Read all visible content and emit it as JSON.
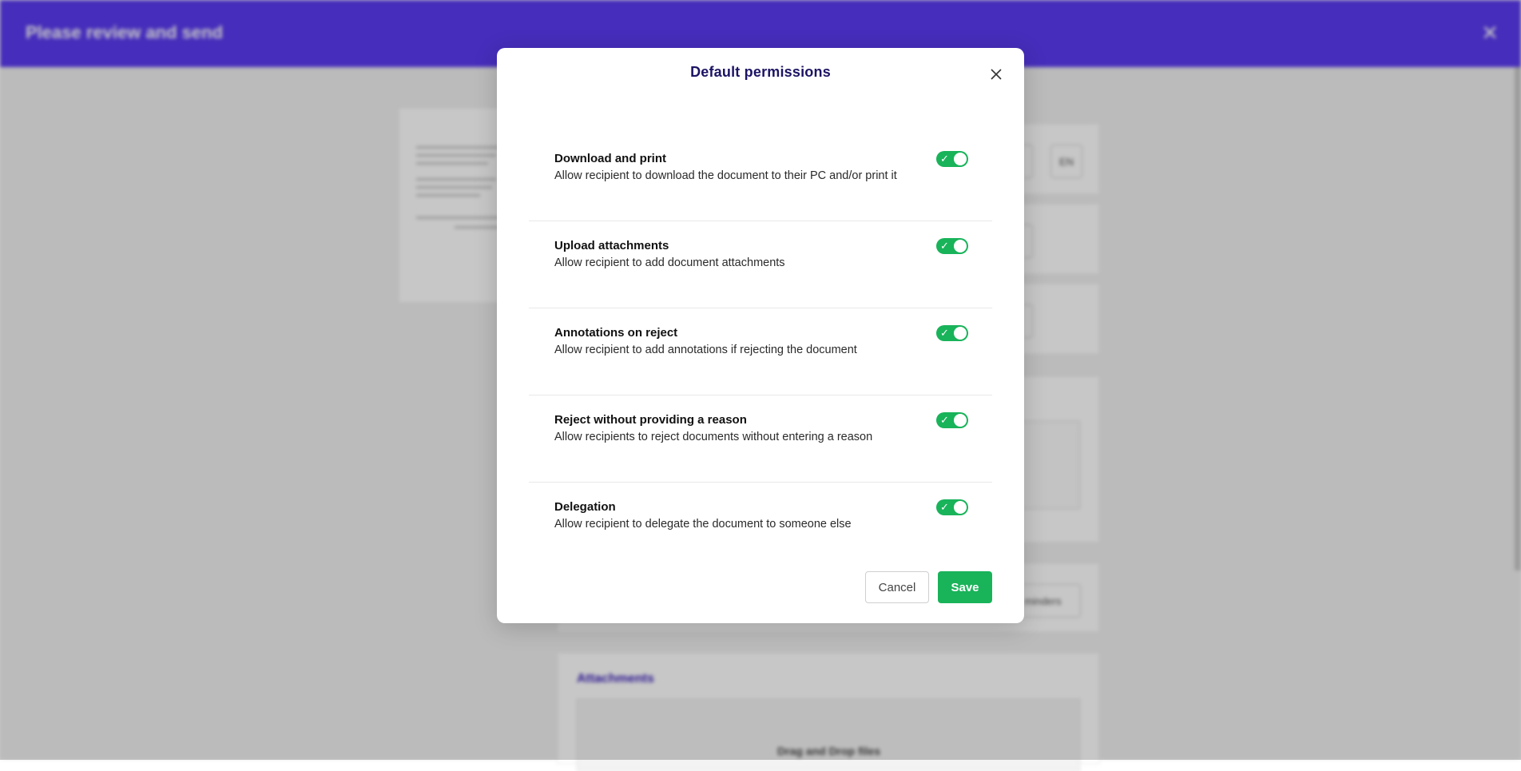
{
  "background": {
    "header_title": "Please review and send",
    "close_glyph": "✕",
    "language_chip": "EN",
    "reminders_chip": "minders",
    "attachments_title": "Attachments",
    "drop_text": "Drag and Drop files",
    "header_color": "#5a3af0"
  },
  "modal": {
    "title": "Default permissions",
    "permissions": [
      {
        "title": "Download and print",
        "description": "Allow recipient to download the document to their PC and/or print it",
        "enabled": true
      },
      {
        "title": "Upload attachments",
        "description": "Allow recipient to add document attachments",
        "enabled": true
      },
      {
        "title": "Annotations on reject",
        "description": "Allow recipient to add annotations if rejecting the document",
        "enabled": true
      },
      {
        "title": "Reject without providing a reason",
        "description": "Allow recipients to reject documents without entering a reason",
        "enabled": true
      },
      {
        "title": "Delegation",
        "description": "Allow recipient to delegate the document to someone else",
        "enabled": true
      }
    ],
    "toggle_check_glyph": "✓",
    "cancel_label": "Cancel",
    "save_label": "Save",
    "accent_color": "#19b35a",
    "title_color": "#1c1464"
  }
}
